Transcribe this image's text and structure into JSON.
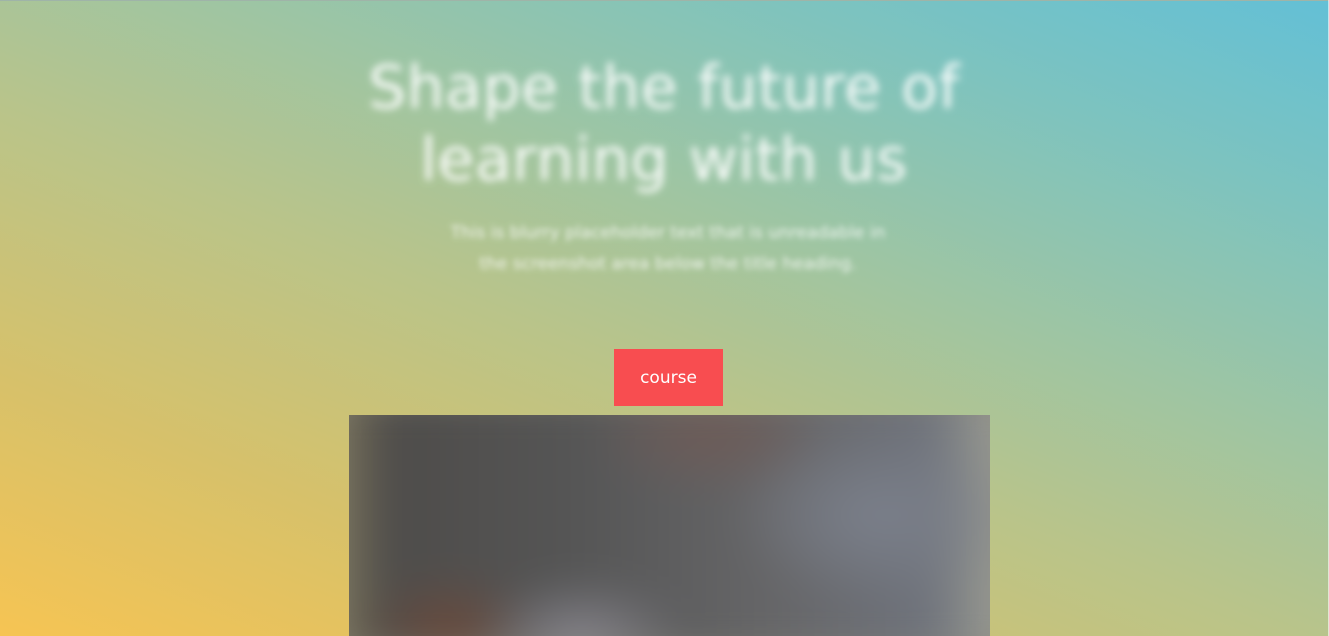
{
  "hero": {
    "title": "Shape the future of learning with us",
    "subtitle": "This is blurry placeholder text that is unreadable in the screenshot area below the title heading."
  },
  "cta": {
    "course_label": "course"
  },
  "colors": {
    "accent": "#f84d50",
    "gradient_warm": "#f6c453",
    "gradient_cool": "#63c0d6"
  }
}
